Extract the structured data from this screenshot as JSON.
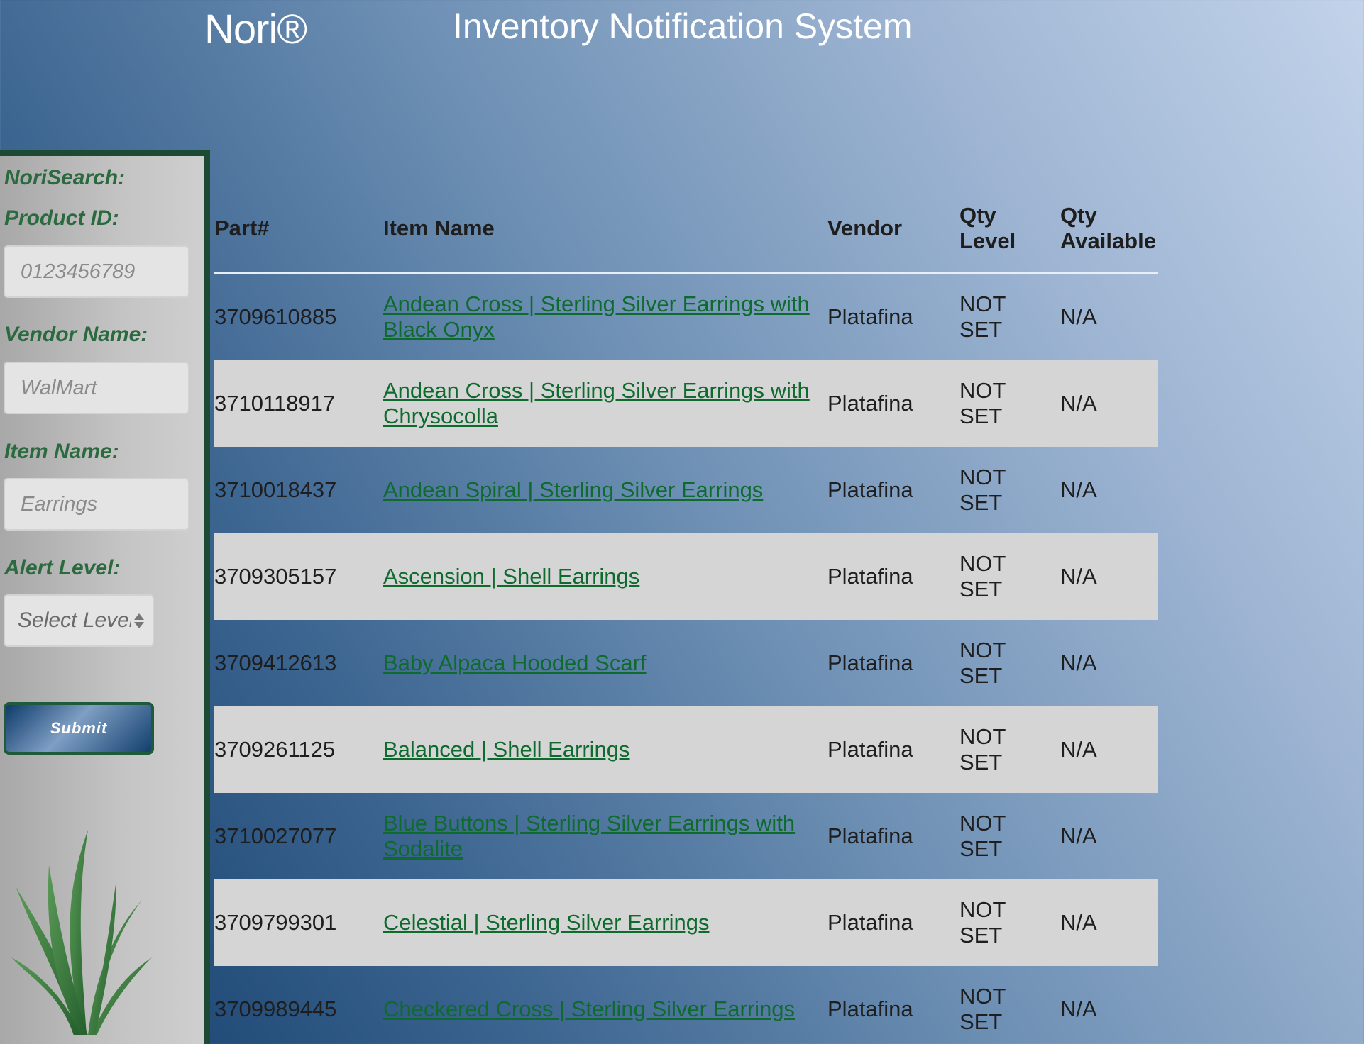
{
  "header": {
    "brand": "Nori®",
    "title": "Inventory Notification System"
  },
  "sidebar": {
    "title": "NoriSearch:",
    "product_id": {
      "label": "Product ID:",
      "placeholder": "0123456789"
    },
    "vendor": {
      "label": "Vendor Name:",
      "placeholder": "WalMart"
    },
    "item_name": {
      "label": "Item Name:",
      "placeholder": "Earrings"
    },
    "alert": {
      "label": "Alert Level:",
      "selected": "Select Level"
    },
    "submit_label": "Submit",
    "logo_icon": "grass-icon"
  },
  "table": {
    "columns": {
      "part": "Part#",
      "name": "Item Name",
      "vendor": "Vendor",
      "level_1": "Qty",
      "level_2": "Level",
      "avail_1": "Qty",
      "avail_2": "Available"
    },
    "rows": [
      {
        "part": "3709610885",
        "name": "Andean Cross | Sterling Silver Earrings with Black Onyx",
        "vendor": "Platafina",
        "level_1": "NOT",
        "level_2": "SET",
        "avail": "N/A"
      },
      {
        "part": "3710118917",
        "name": "Andean Cross | Sterling Silver Earrings with Chrysocolla",
        "vendor": "Platafina",
        "level_1": "NOT",
        "level_2": "SET",
        "avail": "N/A"
      },
      {
        "part": "3710018437",
        "name": "Andean Spiral | Sterling Silver Earrings",
        "vendor": "Platafina",
        "level_1": "NOT",
        "level_2": "SET",
        "avail": "N/A"
      },
      {
        "part": "3709305157",
        "name": "Ascension | Shell Earrings",
        "vendor": "Platafina",
        "level_1": "NOT",
        "level_2": "SET",
        "avail": "N/A"
      },
      {
        "part": "3709412613",
        "name": "Baby Alpaca Hooded Scarf",
        "vendor": "Platafina",
        "level_1": "NOT",
        "level_2": "SET",
        "avail": "N/A"
      },
      {
        "part": "3709261125",
        "name": "Balanced | Shell Earrings",
        "vendor": "Platafina",
        "level_1": "NOT",
        "level_2": "SET",
        "avail": "N/A"
      },
      {
        "part": "3710027077",
        "name": "Blue Buttons | Sterling Silver Earrings with Sodalite",
        "vendor": "Platafina",
        "level_1": "NOT",
        "level_2": "SET",
        "avail": "N/A"
      },
      {
        "part": "3709799301",
        "name": "Celestial | Sterling Silver Earrings",
        "vendor": "Platafina",
        "level_1": "NOT",
        "level_2": "SET",
        "avail": "N/A"
      },
      {
        "part": "3709989445",
        "name": "Checkered Cross | Sterling Silver Earrings",
        "vendor": "Platafina",
        "level_1": "NOT",
        "level_2": "SET",
        "avail": "N/A"
      }
    ]
  },
  "colors": {
    "accent_green": "#2b6a3e",
    "link_green": "#0e6b2d",
    "sidebar_border": "#1d4a33",
    "row_light": "#d5d5d5"
  }
}
